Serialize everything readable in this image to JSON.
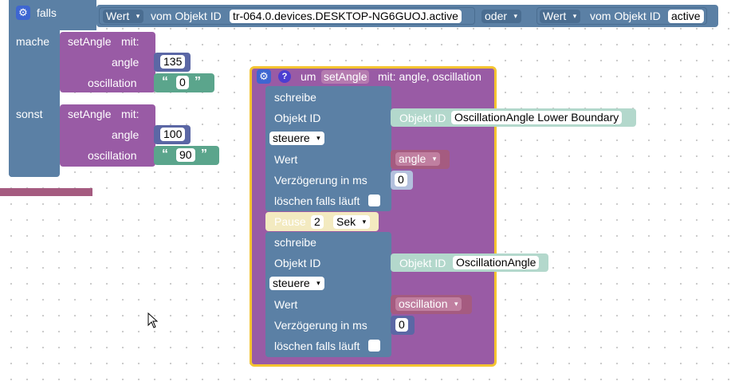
{
  "if_block": {
    "label_if": "falls",
    "label_do": "mache",
    "label_else": "sonst",
    "cond": {
      "left": {
        "field": "Wert",
        "text": "vom Objekt ID",
        "oid": "tr-064.0.devices.DESKTOP-NG6GUOJ.active"
      },
      "op": "oder",
      "right": {
        "field": "Wert",
        "text": "vom Objekt ID",
        "oid": "active"
      }
    }
  },
  "calls": [
    {
      "name": "setAngle",
      "mit": "mit:",
      "arg1_label": "angle",
      "arg1_value": "135",
      "arg2_label": "oscillation",
      "arg2_value": "0"
    },
    {
      "name": "setAngle",
      "mit": "mit:",
      "arg1_label": "angle",
      "arg1_value": "100",
      "arg2_label": "oscillation",
      "arg2_value": "90"
    }
  ],
  "quote_open": "“",
  "quote_close": "”",
  "func": {
    "prefix": "um",
    "name": "setAngle",
    "suffix": "mit: angle, oscillation"
  },
  "write1": {
    "title": "schreibe",
    "oid_label": "Objekt ID",
    "oid_block_label": "Objekt ID",
    "oid_value": "OscillationAngle Lower Boundary",
    "mode": "steuere",
    "value_label": "Wert",
    "value_var": "angle",
    "delay_label": "Verzögerung in ms",
    "delay_value": "0",
    "clear_label": "löschen falls läuft"
  },
  "pause": {
    "label": "Pause",
    "value": "2",
    "unit": "Sek"
  },
  "write2": {
    "title": "schreibe",
    "oid_label": "Objekt ID",
    "oid_block_label": "Objekt ID",
    "oid_value": "OscillationAngle",
    "mode": "steuere",
    "value_label": "Wert",
    "value_var": "oscillation",
    "delay_label": "Verzögerung in ms",
    "delay_value": "0",
    "clear_label": "löschen falls läuft"
  },
  "colors": {
    "logic": "#5b80a5",
    "procedure": "#995ba5",
    "text": "#5ba58c",
    "math": "#5b67a5",
    "variable": "#a55b80",
    "highlight": "#f4c430"
  },
  "icons": {
    "gear": "⚙",
    "help": "?",
    "dropdown": "▾"
  }
}
